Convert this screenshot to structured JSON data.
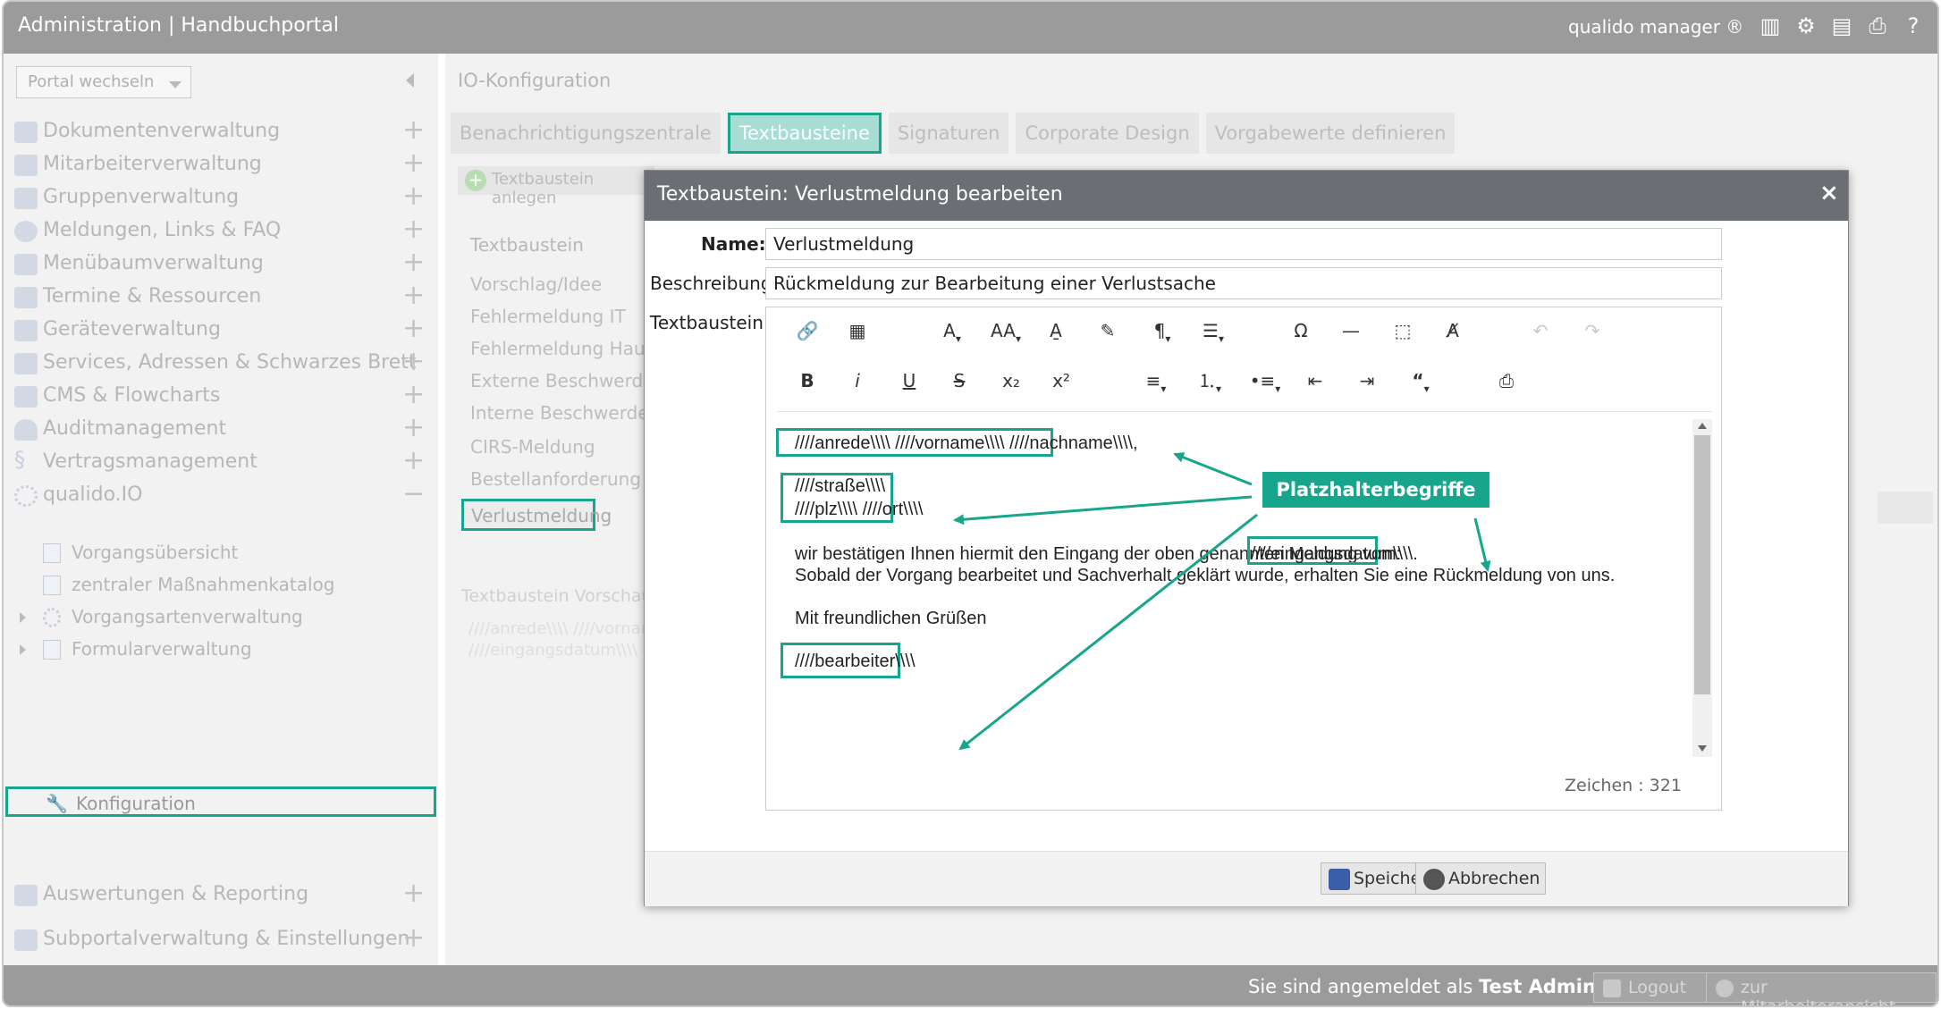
{
  "topbar": {
    "title": "Administration | Handbuchportal",
    "brand": "qualido manager ®",
    "icons": [
      "barcode-icon",
      "sitemap-icon",
      "server-icon",
      "printer-icon",
      "help-icon"
    ]
  },
  "sidebar": {
    "portal_select": "Portal wechseln",
    "items": [
      {
        "label": "Dokumentenverwaltung",
        "icon": "documents-icon"
      },
      {
        "label": "Mitarbeiterverwaltung",
        "icon": "users-icon"
      },
      {
        "label": "Gruppenverwaltung",
        "icon": "groups-icon"
      },
      {
        "label": "Meldungen, Links & FAQ",
        "icon": "chat-icon"
      },
      {
        "label": "Menübaumverwaltung",
        "icon": "list-icon"
      },
      {
        "label": "Termine & Ressourcen",
        "icon": "calendar-icon"
      },
      {
        "label": "Geräteverwaltung",
        "icon": "monitor-icon"
      },
      {
        "label": "Services, Adressen & Schwarzes Brett",
        "icon": "address-icon"
      },
      {
        "label": "CMS & Flowcharts",
        "icon": "cms-icon"
      },
      {
        "label": "Auditmanagement",
        "icon": "audit-icon"
      },
      {
        "label": "Vertragsmanagement",
        "icon": "paragraph-icon"
      },
      {
        "label": "qualido.IO",
        "icon": "io-icon"
      }
    ],
    "subitems": [
      {
        "label": "Vorgangsübersicht"
      },
      {
        "label": "zentraler Maßnahmenkatalog"
      },
      {
        "label": "Vorgangsartenverwaltung"
      },
      {
        "label": "Formularverwaltung"
      },
      {
        "label": "Konfiguration"
      }
    ],
    "bottom_items": [
      {
        "label": "Auswertungen & Reporting"
      },
      {
        "label": "Subportalverwaltung & Einstellungen"
      }
    ]
  },
  "content": {
    "title": "IO-Konfiguration",
    "tabs": [
      "Benachrichtigungszentrale",
      "Textbausteine",
      "Signaturen",
      "Corporate Design",
      "Vorgabewerte definieren"
    ],
    "add_button": "Textbaustein anlegen",
    "list_header": "Textbaustein",
    "list": [
      "Vorschlag/Idee",
      "Fehlermeldung IT",
      "Fehlermeldung Haus",
      "Externe Beschwerde",
      "Interne Beschwerde",
      "CIRS-Meldung",
      "Bestellanforderung",
      "Verlustmeldung"
    ],
    "preview_header": "Textbaustein Vorschau",
    "preview_line1": "////anrede\\\\\\\\ ////vorname",
    "preview_line2": "////eingangsdatum\\\\\\\\"
  },
  "dialog": {
    "title": "Textbaustein: Verlustmeldung bearbeiten",
    "close": "×",
    "name_label": "Name:",
    "name_value": "Verlustmeldung",
    "desc_label": "Beschreibung",
    "desc_value": "Rückmeldung zur Bearbeitung einer Verlustsache",
    "text_label": "Textbaustein:",
    "editor": {
      "line_greeting": "////anrede\\\\\\\\ ////vorname\\\\\\\\ ////nachname\\\\\\\\,",
      "line_street": "////straße\\\\\\\\",
      "line_city": "////plz\\\\\\\\ ////ort\\\\\\\\",
      "line_confirm": "wir bestätigen Ihnen hiermit den Eingang der oben genannten Meldung vom:",
      "line_date": "////eingangsdatum\\\\\\\\.",
      "line_process": "Sobald der Vorgang bearbeitet und Sachverhalt geklärt wurde, erhalten Sie eine Rückmeldung von uns.",
      "line_regards": "Mit freundlichen Grüßen",
      "line_clerk": "////bearbeiter\\\\\\\\",
      "counter": "Zeichen : 321"
    },
    "save_button": "Speichern",
    "cancel_button": "Abbrechen"
  },
  "callout": "Platzhalterbegriffe",
  "footer": {
    "status_prefix": "Sie sind angemeldet als",
    "user": "Test Admin",
    "logout": "Logout",
    "employee_view": "zur Mitarbeiteransicht"
  },
  "colors": {
    "accent": "#17a58b",
    "header": "#9b9b9b",
    "dialog_header": "#6b6f73"
  }
}
